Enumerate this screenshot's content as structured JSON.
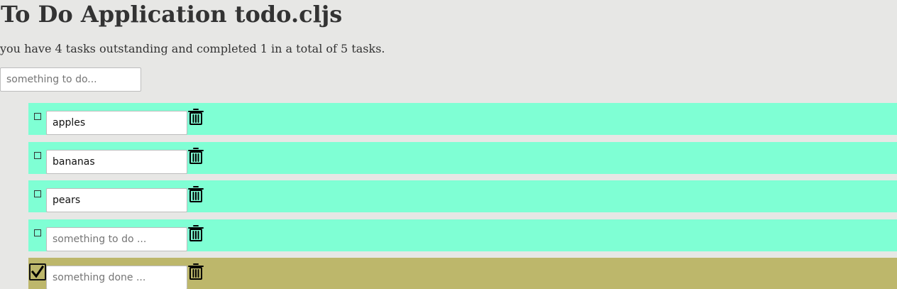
{
  "header": {
    "title": "To Do Application todo.cljs",
    "summary": "you have 4 tasks outstanding and completed 1 in a total of 5 tasks."
  },
  "new_task": {
    "placeholder": "something to do...",
    "value": ""
  },
  "tasks": [
    {
      "value": "apples",
      "placeholder": "something to do ...",
      "completed": false,
      "icon": "trash-icon"
    },
    {
      "value": "bananas",
      "placeholder": "something to do ...",
      "completed": false,
      "icon": "trash-icon"
    },
    {
      "value": "pears",
      "placeholder": "something to do ...",
      "completed": false,
      "icon": "trash-icon"
    },
    {
      "value": "",
      "placeholder": "something to do ...",
      "completed": false,
      "icon": "trash-icon"
    },
    {
      "value": "",
      "placeholder": "something done ...",
      "completed": true,
      "icon": "trash-icon"
    }
  ],
  "colors": {
    "background": "#e7e7e5",
    "open_row": "#7fffd4",
    "done_row": "#bdb76b",
    "text": "#333333"
  }
}
